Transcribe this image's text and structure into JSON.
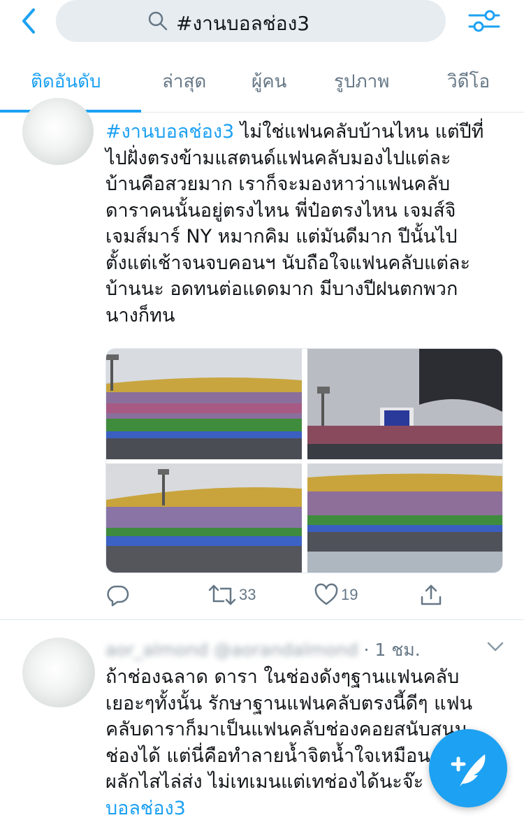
{
  "search": {
    "query": "#งานบอลช่อง3"
  },
  "tabs": [
    {
      "label": "ติดอันดับ"
    },
    {
      "label": "ล่าสุด"
    },
    {
      "label": "ผู้คน"
    },
    {
      "label": "รูปภาพ"
    },
    {
      "label": "วิดีโอ"
    }
  ],
  "tweet1": {
    "hashtag": "#งานบอลช่อง3",
    "lines": [
      " ไม่ใช่แฟนคลับบ้านไหน แต่ปีที่",
      "ไปฝั่งตรงข้ามแสตนด์แฟนคลับมองไปแต่ละ",
      "บ้านคือสวยมาก เราก็จะมองหาว่าแฟนคลับ",
      "ดาราคนนั้นอยู่ตรงไหน พี่ป๋อตรงไหน เจมส์จิ",
      "เจมส์มาร์ NY หมากคิม แต่มันดีมาก ปีนั้นไป",
      "ตั้งแต่เช้าจนจบคอนฯ นับถือใจแฟนคลับแต่ละ",
      "บ้านนะ อดทนต่อแดดมาก มีบางปีฝนตกพวก",
      "นางก็ทน"
    ],
    "retweets": "33",
    "likes": "19"
  },
  "tweet2": {
    "name": "aor_almond",
    "handle": "@aorandalmond",
    "time": "· 1 ชม.",
    "lines": [
      "ถ้าช่องฉลาด ดารา ในช่องดังๆฐานแฟนคลับ",
      "เยอะๆทั้งนั้น รักษาฐานแฟนคลับตรงนี้ดีๆ แฟน",
      "คลับดาราก็มาเป็นแฟนคลับช่องคอยสนับสนุน",
      "ช่องได้ แต่นี่คือทำลายน้ำจิตน้ำใจเหมือน",
      "ผลักไสไล่ส่ง ไม่เทเมนแต่เทช่องได้นะจ๊ะ"
    ],
    "hashtag_tail": "บอลช่อง3"
  },
  "colors": {
    "accent": "#1da1f2",
    "text": "#14171a",
    "muted": "#657786",
    "border": "#e1e8ed"
  }
}
